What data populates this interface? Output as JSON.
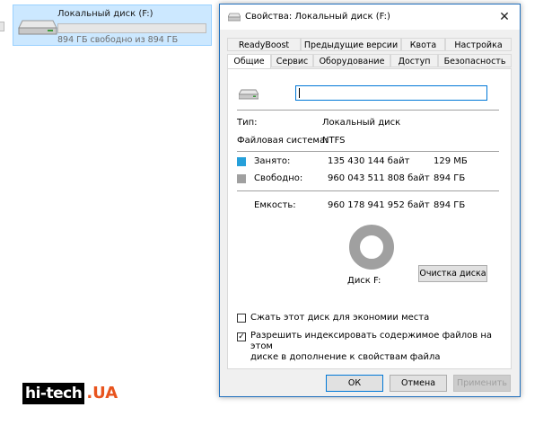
{
  "explorer": {
    "drive_name": "Локальный диск (F:)",
    "free_text": "894 ГБ свободно из 894 ГБ",
    "usage_fraction": 0.0
  },
  "window": {
    "title": "Свойства: Локальный диск (F:)",
    "close_glyph": "✕",
    "tabs_row1": [
      "ReadyBoost",
      "Предыдущие версии",
      "Квота",
      "Настройка"
    ],
    "tabs_row2": [
      "Общие",
      "Сервис",
      "Оборудование",
      "Доступ",
      "Безопасность"
    ],
    "active_tab": "Общие",
    "label_value": ""
  },
  "general": {
    "type_label": "Тип:",
    "type_value": "Локальный диск",
    "fs_label": "Файловая система:",
    "fs_value": "NTFS",
    "used_label": "Занято:",
    "used_bytes": "135 430 144 байт",
    "used_short": "129 МБ",
    "free_label": "Свободно:",
    "free_bytes": "960 043 511 808 байт",
    "free_short": "894 ГБ",
    "capacity_label": "Емкость:",
    "capacity_bytes": "960 178 941 952 байт",
    "capacity_short": "894 ГБ",
    "disk_caption": "Диск F:",
    "cleanup_button": "Очистка диска",
    "compress_label": "Сжать этот диск для экономии места",
    "compress_checked": false,
    "index_label_line1": "Разрешить индексировать содержимое файлов на этом",
    "index_label_line2": "диске в дополнение к свойствам файла",
    "index_checked": true,
    "checkmark": "✓"
  },
  "buttons": {
    "ok": "ОК",
    "cancel": "Отмена",
    "apply": "Применить"
  },
  "colors": {
    "used": "#26a0da",
    "free": "#a0a0a0",
    "selection": "#cce8ff"
  },
  "watermark": {
    "part1": "hi-tech",
    "part2": ".UA"
  }
}
